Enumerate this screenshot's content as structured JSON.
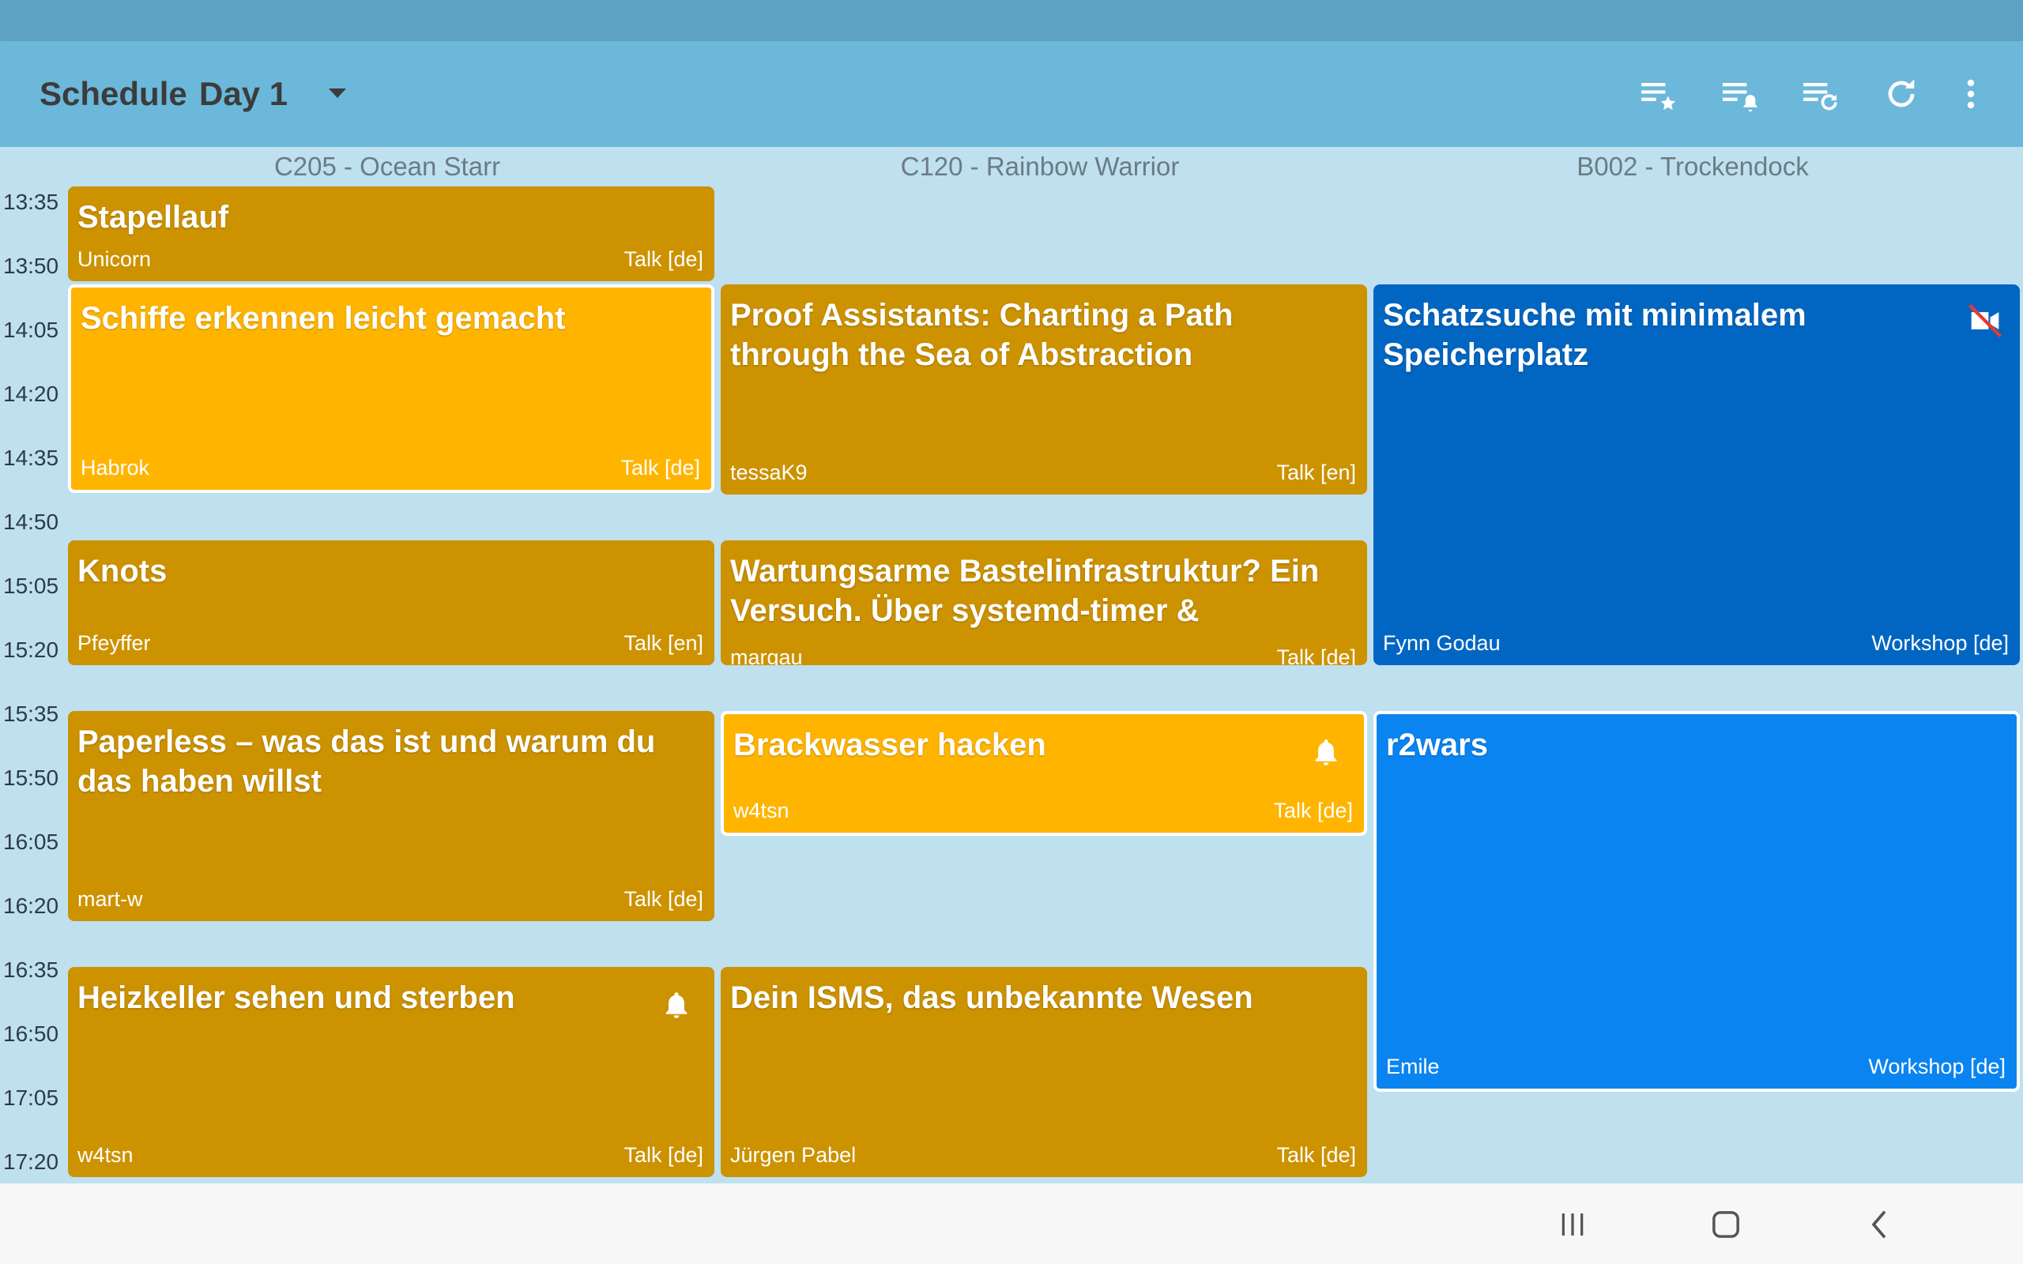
{
  "app": {
    "title": "Schedule",
    "day": "Day 1",
    "colors": {
      "appbar": "#6bb8da",
      "statusbar": "#5fa3c4",
      "talk": "#cc9200",
      "talk_highlight": "#ffb400",
      "workshop": "#0066c2",
      "workshop_highlight": "#0a84f0"
    }
  },
  "actions": [
    {
      "name": "starred-list-icon",
      "label": "Favorites"
    },
    {
      "name": "alarm-list-icon",
      "label": "Alarms"
    },
    {
      "name": "change-list-icon",
      "label": "Changes"
    },
    {
      "name": "refresh-icon",
      "label": "Refresh"
    },
    {
      "name": "more-vert-icon",
      "label": "More options"
    }
  ],
  "rooms": [
    "C205 - Ocean Starr",
    "C120 - Rainbow Warrior",
    "B002 - Trockendock"
  ],
  "times": [
    "13:35",
    "13:50",
    "14:05",
    "14:20",
    "14:35",
    "14:50",
    "15:05",
    "15:20",
    "15:35",
    "15:50",
    "16:05",
    "16:20",
    "16:35",
    "16:50",
    "17:05",
    "17:20"
  ],
  "events": [
    {
      "title": "Stapellauf",
      "speaker": "Unicorn",
      "type": "Talk [de]"
    },
    {
      "title": "Schiffe erkennen leicht gemacht",
      "speaker": "Habrok",
      "type": "Talk [de]"
    },
    {
      "title": "Knots",
      "speaker": "Pfeyffer",
      "type": "Talk [en]"
    },
    {
      "title": "Paperless – was das ist und warum du das haben willst",
      "speaker": "mart-w",
      "type": "Talk [de]"
    },
    {
      "title": "Heizkeller sehen und sterben",
      "speaker": "w4tsn",
      "type": "Talk [de]"
    },
    {
      "title": "Proof Assistants: Charting a Path through the Sea of Abstraction",
      "speaker": "tessaK9",
      "type": "Talk [en]"
    },
    {
      "title": "Wartungsarme Bastelinfrastruktur? Ein Versuch. Über systemd-timer & ähnliche Tools",
      "speaker": "margau",
      "type": "Talk [de]"
    },
    {
      "title": "Brackwasser hacken",
      "speaker": "w4tsn",
      "type": "Talk [de]"
    },
    {
      "title": "Dein ISMS, das unbekannte Wesen",
      "speaker": "Jürgen Pabel",
      "type": "Talk [de]"
    },
    {
      "title": "Schatzsuche mit minimalem Speicherplatz",
      "speaker": "Fynn Godau",
      "type": "Workshop [de]"
    },
    {
      "title": "r2wars",
      "speaker": "Emile",
      "type": "Workshop [de]"
    }
  ],
  "nav": {
    "recents": "recents-icon",
    "home": "home-icon",
    "back": "back-icon"
  }
}
